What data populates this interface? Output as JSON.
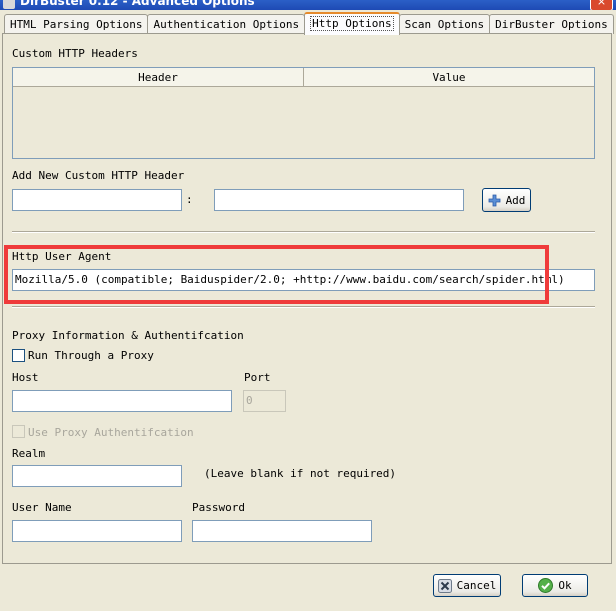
{
  "window": {
    "title": "DirBuster 0.12 - Advanced Options",
    "close_glyph": "×"
  },
  "tabs": [
    {
      "label": "HTML Parsing Options"
    },
    {
      "label": "Authentication Options"
    },
    {
      "label": "Http Options"
    },
    {
      "label": "Scan Options"
    },
    {
      "label": "DirBuster Options"
    }
  ],
  "custom_headers": {
    "section_label": "Custom HTTP Headers",
    "columns": [
      "Header",
      "Value"
    ]
  },
  "add_header": {
    "label": "Add New Custom HTTP Header",
    "separator": ":",
    "header_value": "",
    "value_value": "",
    "add_button": "Add"
  },
  "user_agent": {
    "label": "Http User Agent",
    "value": "Mozilla/5.0 (compatible; Baiduspider/2.0; +http://www.baidu.com/search/spider.html)"
  },
  "proxy": {
    "section_label": "Proxy Information & Authentifcation",
    "run_through_proxy": "Run Through a Proxy",
    "host_label": "Host",
    "host_value": "",
    "port_label": "Port",
    "port_value": "0",
    "use_proxy_auth": "Use Proxy Authentifcation",
    "realm_label": "Realm",
    "realm_value": "",
    "realm_hint": "(Leave blank if not required)",
    "username_label": "User Name",
    "username_value": "",
    "password_label": "Password",
    "password_value": ""
  },
  "footer": {
    "cancel": "Cancel",
    "ok": "Ok"
  },
  "colors": {
    "highlight": "#ef3b3b",
    "active_tab_accent": "#e68b2c",
    "dialog_bg": "#ece9d8"
  }
}
